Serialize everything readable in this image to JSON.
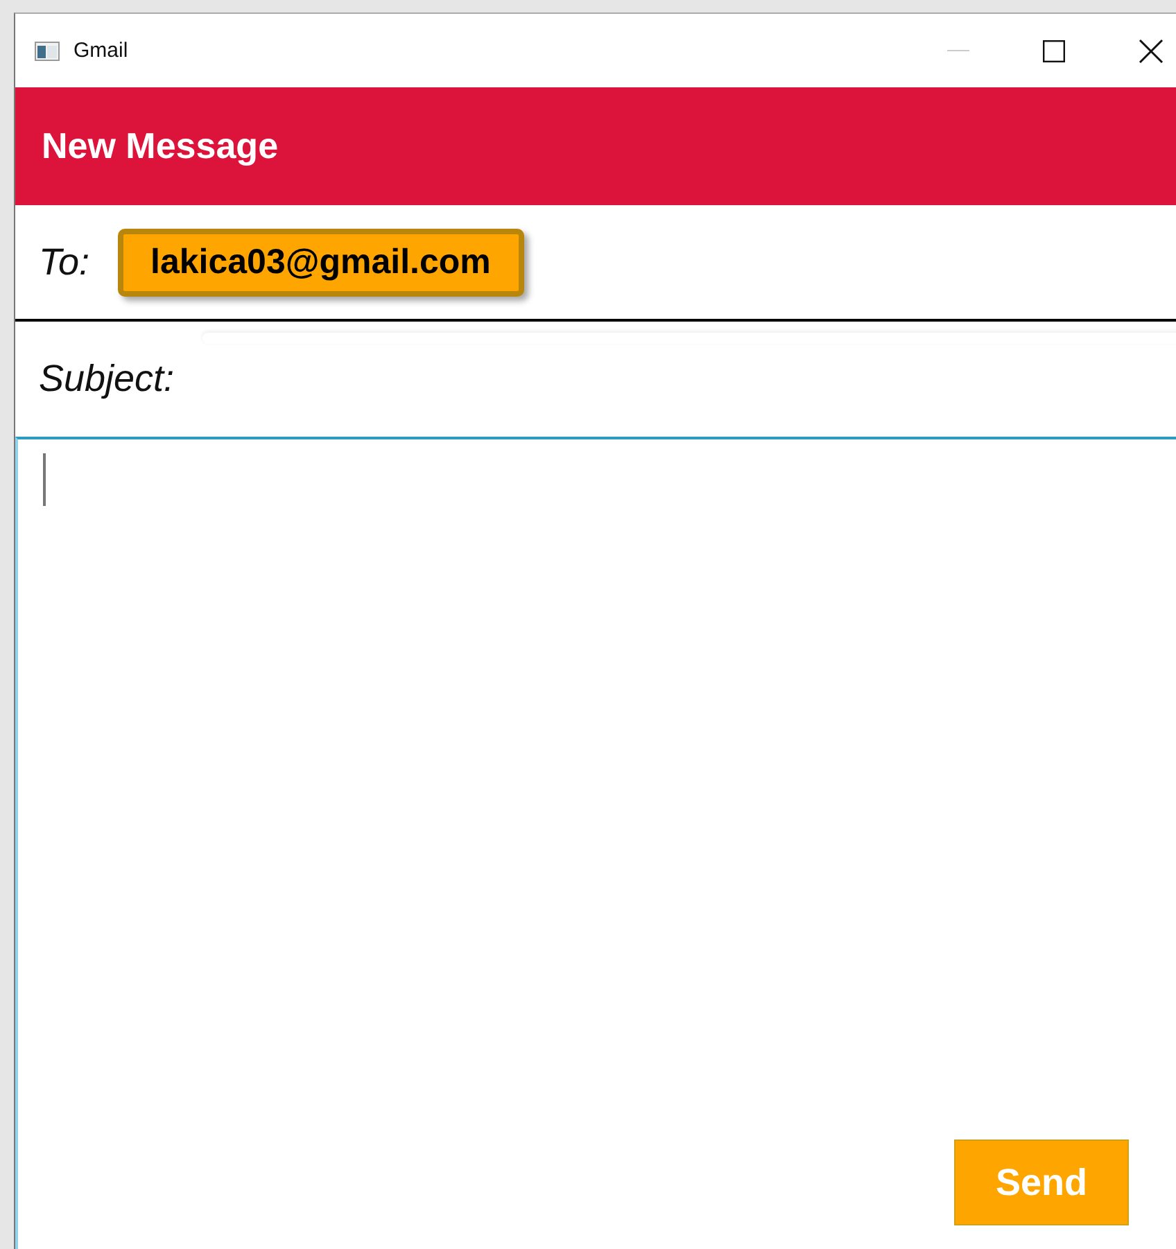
{
  "window": {
    "title": "Gmail"
  },
  "header": {
    "title": "New Message"
  },
  "to": {
    "label": "To:",
    "recipient": "lakica03@gmail.com"
  },
  "subject": {
    "label": "Subject:"
  },
  "send_button": {
    "label": "Send"
  }
}
